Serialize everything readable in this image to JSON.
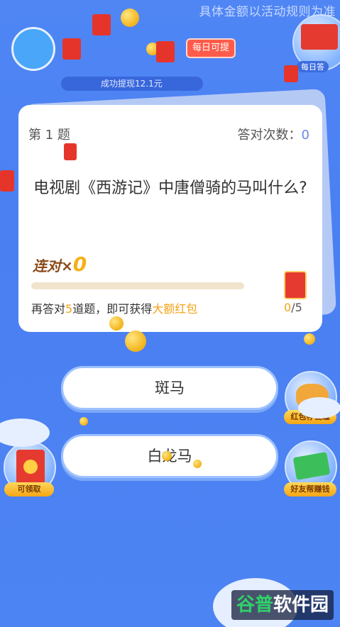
{
  "header": {
    "disclaimer": "具体金额以活动规则为准",
    "daily_withdraw_label": "每日可提",
    "withdraw_ticker": "成功提现12.1元",
    "daily_answer_label": "每日答"
  },
  "question_card": {
    "number_label": "第 1 题",
    "answer_count_label": "答对次数：",
    "answer_count_value": "0",
    "question_text": "电视剧《西游记》中唐僧骑的马叫什么?",
    "streak_label": "连对×",
    "streak_value": "0",
    "progress_fraction": 0.0,
    "reward_text_prefix": "再答对",
    "reward_text_count": "5",
    "reward_text_middle": "道题，即可获得",
    "reward_text_highlight": "大额红包",
    "reward_progress_current": "0",
    "reward_progress_total": "/5"
  },
  "options": [
    {
      "label": "斑马"
    },
    {
      "label": "白龙马"
    }
  ],
  "side_buttons": {
    "piggy_bank_label": "红包存钱罐",
    "friends_help_label": "好友帮赚钱",
    "claimable_label": "可领取"
  },
  "watermark": {
    "text_a": "谷普",
    "text_b": "软件园"
  },
  "colors": {
    "background": "#4f86f4",
    "accent_orange": "#f5a218",
    "red_packet": "#e53a2f"
  }
}
